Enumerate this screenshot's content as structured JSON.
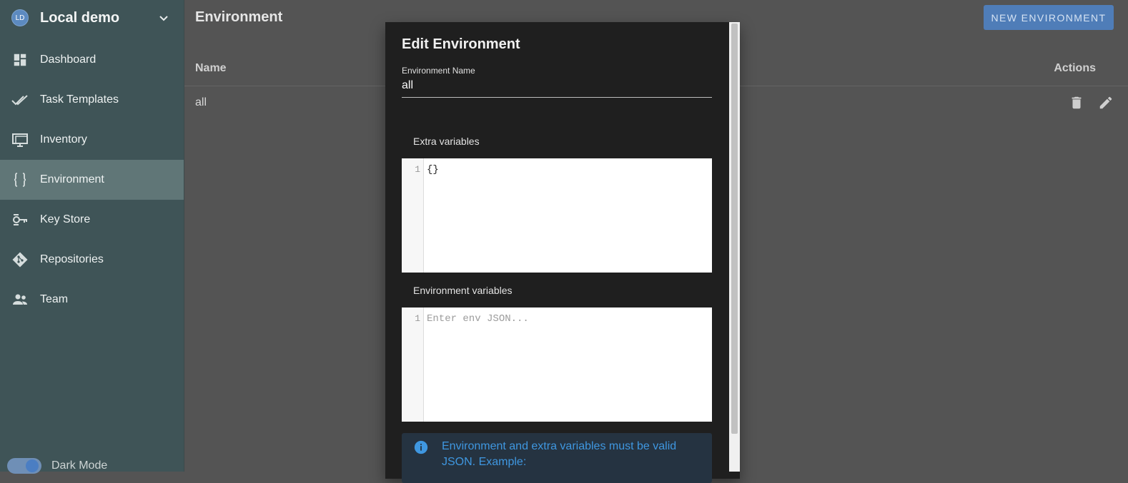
{
  "sidebar": {
    "project": {
      "initials": "LD",
      "name": "Local demo"
    },
    "items": [
      {
        "label": "Dashboard",
        "icon": "dashboard-icon",
        "active": false
      },
      {
        "label": "Task Templates",
        "icon": "double-check-icon",
        "active": false
      },
      {
        "label": "Inventory",
        "icon": "monitor-icon",
        "active": false
      },
      {
        "label": "Environment",
        "icon": "braces-icon",
        "active": true
      },
      {
        "label": "Key Store",
        "icon": "key-icon",
        "active": false
      },
      {
        "label": "Repositories",
        "icon": "git-icon",
        "active": false
      },
      {
        "label": "Team",
        "icon": "people-icon",
        "active": false
      }
    ],
    "dark_mode_label": "Dark Mode"
  },
  "main": {
    "title": "Environment",
    "new_button": "NEW ENVIRONMENT",
    "table": {
      "headers": {
        "name": "Name",
        "actions": "Actions"
      },
      "rows": [
        {
          "name": "all"
        }
      ]
    }
  },
  "dialog": {
    "title": "Edit Environment",
    "name_label": "Environment Name",
    "name_value": "all",
    "extra_label": "Extra variables",
    "extra_line": "1",
    "extra_code": "{}",
    "env_label": "Environment variables",
    "env_line": "1",
    "env_placeholder": "Enter env JSON...",
    "alert_text": "Environment and extra variables must be valid JSON. Example:"
  },
  "colors": {
    "sidebar_bg": "#3f5457",
    "active_item": "#607677",
    "accent": "#4f7db8",
    "dialog_bg": "#1f1f1f",
    "info_text": "#3f97e0"
  }
}
